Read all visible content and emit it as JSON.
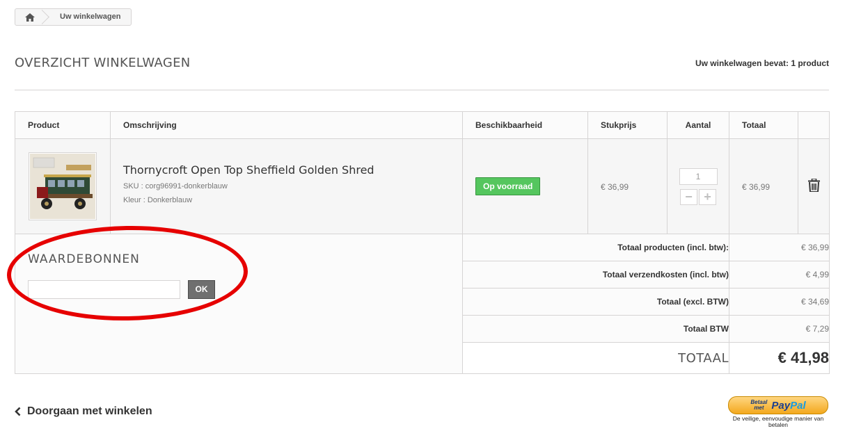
{
  "breadcrumb": {
    "home_icon": "home-icon",
    "label": "Uw winkelwagen"
  },
  "page": {
    "title": "OVERZICHT WINKELWAGEN",
    "cart_count": "Uw winkelwagen bevat: 1 product"
  },
  "table": {
    "headers": {
      "product": "Product",
      "description": "Omschrijving",
      "availability": "Beschikbaarheid",
      "unit_price": "Stukprijs",
      "quantity": "Aantal",
      "total": "Totaal"
    },
    "item": {
      "name": "Thornycroft Open Top Sheffield Golden Shred",
      "sku": "SKU : corg96991-donkerblauw",
      "color": "Kleur : Donkerblauw",
      "availability": "Op voorraad",
      "unit_price": "€ 36,99",
      "quantity": "1",
      "total": "€ 36,99",
      "delete_icon": "trash-icon"
    }
  },
  "voucher": {
    "title": "WAARDEBONNEN",
    "input_value": "",
    "button": "OK"
  },
  "summary": {
    "rows": [
      {
        "label": "Totaal producten (incl. btw):",
        "value": "€ 36,99"
      },
      {
        "label": "Totaal verzendkosten (incl. btw)",
        "value": "€ 4,99"
      },
      {
        "label": "Totaal (excl. BTW)",
        "value": "€ 34,69"
      },
      {
        "label": "Totaal BTW",
        "value": "€ 7,29"
      }
    ],
    "total_label": "TOTAAL",
    "total_value": "€ 41,98"
  },
  "footer": {
    "continue_label": "Doorgaan met winkelen",
    "paypal": {
      "pay_line1": "Betaal",
      "pay_line2": "met",
      "brand_pay": "Pay",
      "brand_pal": "Pal",
      "tagline": "De veilige, eenvoudige manier van betalen"
    }
  },
  "colors": {
    "in_stock": "#55c65e",
    "annotation": "#e60000",
    "button_dark": "#6f6f6f"
  }
}
